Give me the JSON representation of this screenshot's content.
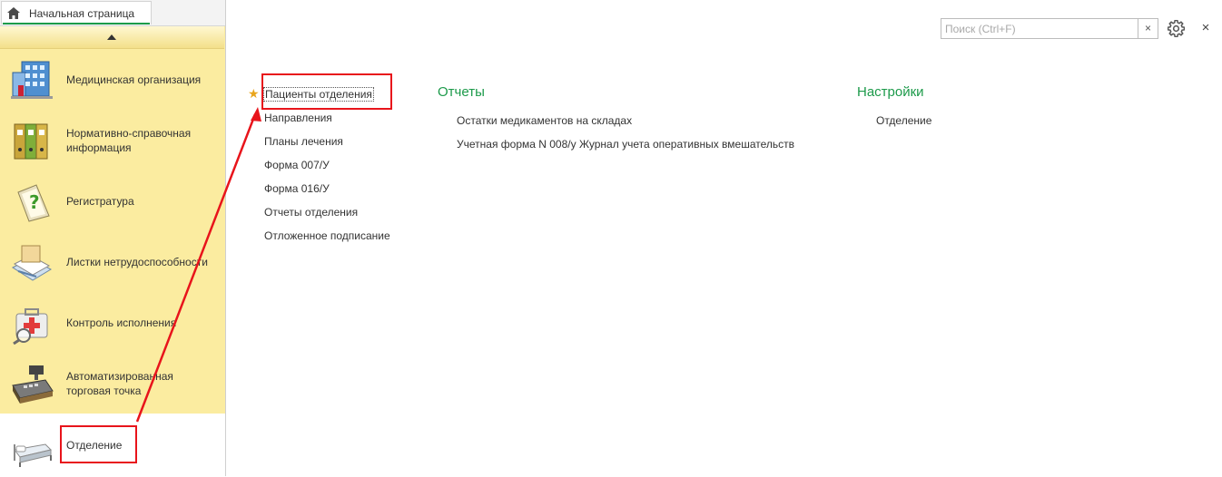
{
  "tabs": {
    "home_label": "Начальная страница"
  },
  "sidebar": {
    "items": [
      {
        "label": "Медицинская организация",
        "icon": "building-icon"
      },
      {
        "label": "Нормативно-справочная информация",
        "icon": "binders-icon"
      },
      {
        "label": "Регистратура",
        "icon": "question-document-icon"
      },
      {
        "label": "Листки нетрудоспособности",
        "icon": "documents-stack-icon"
      },
      {
        "label": "Контроль исполнения",
        "icon": "medkit-search-icon"
      },
      {
        "label": "Автоматизированная торговая точка",
        "icon": "cash-register-icon"
      },
      {
        "label": "Отделение",
        "icon": "hospital-bed-icon",
        "active": true
      }
    ]
  },
  "toolbar": {
    "search_placeholder": "Поиск (Ctrl+F)",
    "clear_label": "×",
    "close_label": "×"
  },
  "main": {
    "links": [
      "Пациенты отделения",
      "Направления",
      "Планы лечения",
      "Форма 007/У",
      "Форма 016/У",
      "Отчеты отделения",
      "Отложенное подписание"
    ],
    "reports": {
      "title": "Отчеты",
      "items": [
        "Остатки медикаментов на складах",
        "Учетная форма N 008/у Журнал учета оперативных вмешательств"
      ]
    },
    "settings": {
      "title": "Настройки",
      "items": [
        "Отделение"
      ]
    }
  },
  "colors": {
    "accent_green": "#1c9a4a",
    "panel_yellow": "#fbeca0",
    "annotation_red": "#e8141b",
    "star": "#e9a51c"
  }
}
